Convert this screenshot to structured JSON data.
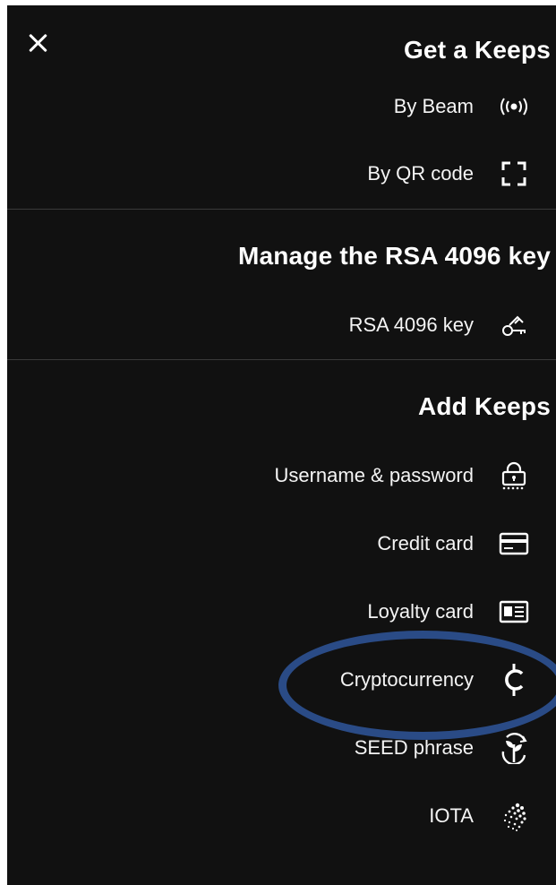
{
  "menu": {
    "close_icon": "close-icon",
    "sections": [
      {
        "title": "Get a Keeps",
        "items": [
          {
            "label": "By Beam",
            "icon": "beam-icon"
          },
          {
            "label": "By QR code",
            "icon": "qr-scan-icon"
          }
        ]
      },
      {
        "title": "Manage the RSA 4096 key",
        "items": [
          {
            "label": "RSA 4096 key",
            "icon": "key-icon"
          }
        ]
      },
      {
        "title": "Add Keeps",
        "items": [
          {
            "label": "Username & password",
            "icon": "lock-password-icon"
          },
          {
            "label": "Credit card",
            "icon": "credit-card-icon"
          },
          {
            "label": "Loyalty card",
            "icon": "loyalty-card-icon"
          },
          {
            "label": "Cryptocurrency",
            "icon": "cryptocurrency-icon"
          },
          {
            "label": "SEED phrase",
            "icon": "seed-icon"
          },
          {
            "label": "IOTA",
            "icon": "iota-icon"
          }
        ]
      }
    ]
  },
  "colors": {
    "background": "#111111",
    "text": "#ffffff",
    "divider": "#3a3a3a",
    "annotation": "#2a4b86"
  }
}
